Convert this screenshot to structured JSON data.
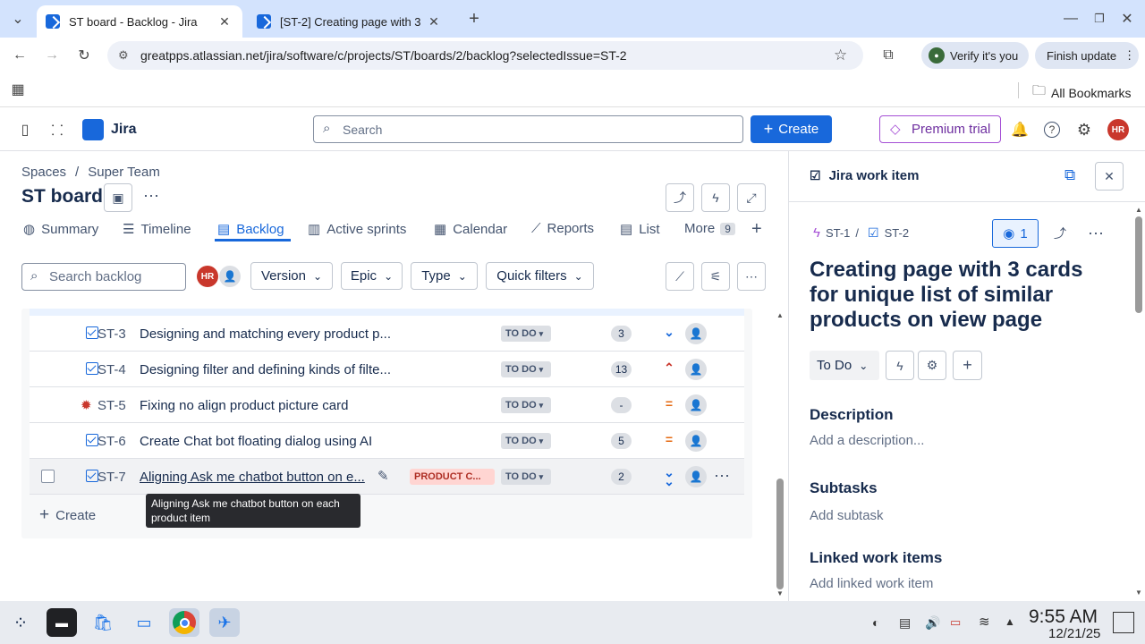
{
  "browser": {
    "tabs": [
      {
        "title": "ST board - Backlog - Jira",
        "active": true
      },
      {
        "title": "[ST-2] Creating page with 3",
        "active": false
      }
    ],
    "url": "greatpps.atlassian.net/jira/software/c/projects/ST/boards/2/backlog?selectedIssue=ST-2",
    "verify_label": "Verify it's you",
    "finish_update_label": "Finish update",
    "all_bookmarks_label": "All Bookmarks"
  },
  "jira": {
    "product_name": "Jira",
    "search_placeholder": "Search",
    "create_label": "Create",
    "premium_label": "Premium trial",
    "user_initials": "HR"
  },
  "board": {
    "breadcrumb": [
      "Spaces",
      "/",
      "Super Team"
    ],
    "title": "ST board",
    "tabs": [
      {
        "label": "Summary",
        "icon": "globe-icon"
      },
      {
        "label": "Timeline",
        "icon": "timeline-icon"
      },
      {
        "label": "Backlog",
        "icon": "backlog-icon",
        "active": true
      },
      {
        "label": "Active sprints",
        "icon": "board-icon"
      },
      {
        "label": "Calendar",
        "icon": "calendar-icon"
      },
      {
        "label": "Reports",
        "icon": "chart-icon"
      },
      {
        "label": "List",
        "icon": "list-icon"
      },
      {
        "label": "More",
        "badge": "9"
      }
    ],
    "search_backlog_placeholder": "Search backlog",
    "filters": [
      "Version",
      "Epic",
      "Type",
      "Quick filters"
    ],
    "issues": [
      {
        "key": "ST-3",
        "summary": "Designing and matching every product p...",
        "status": "TO DO",
        "estimate": "3",
        "priority": "low",
        "type": "task"
      },
      {
        "key": "ST-4",
        "summary": "Designing filter and defining kinds of filte...",
        "status": "TO DO",
        "estimate": "13",
        "priority": "highest",
        "type": "task"
      },
      {
        "key": "ST-5",
        "summary": "Fixing no align product picture card",
        "status": "TO DO",
        "estimate": "-",
        "priority": "medium",
        "type": "bug"
      },
      {
        "key": "ST-6",
        "summary": "Create Chat bot floating dialog using AI",
        "status": "TO DO",
        "estimate": "5",
        "priority": "medium",
        "type": "task"
      },
      {
        "key": "ST-7",
        "summary": "Aligning Ask me chatbot button on e...",
        "status": "TO DO",
        "estimate": "2",
        "priority": "lowest",
        "type": "task",
        "epic": "PRODUCT C..."
      }
    ],
    "create_row_label": "Create",
    "tooltip": "Aligning Ask me chatbot button on each product item"
  },
  "panel": {
    "header": "Jira work item",
    "parent_key": "ST-1",
    "separator": "/",
    "issue_key": "ST-2",
    "watch_count": "1",
    "title": "Creating page with 3 cards for unique list of similar products on view page",
    "status": "To Do",
    "description_heading": "Description",
    "description_placeholder": "Add a description...",
    "subtasks_heading": "Subtasks",
    "subtasks_placeholder": "Add subtask",
    "linked_heading": "Linked work items",
    "linked_placeholder": "Add linked work item"
  },
  "taskbar": {
    "time": "9:55 AM",
    "date": "12/21/25"
  },
  "colors": {
    "brand_blue": "#1868db",
    "priority_orange": "#e56910",
    "priority_red": "#c9372c",
    "epic_bg": "#ffd5d2"
  }
}
